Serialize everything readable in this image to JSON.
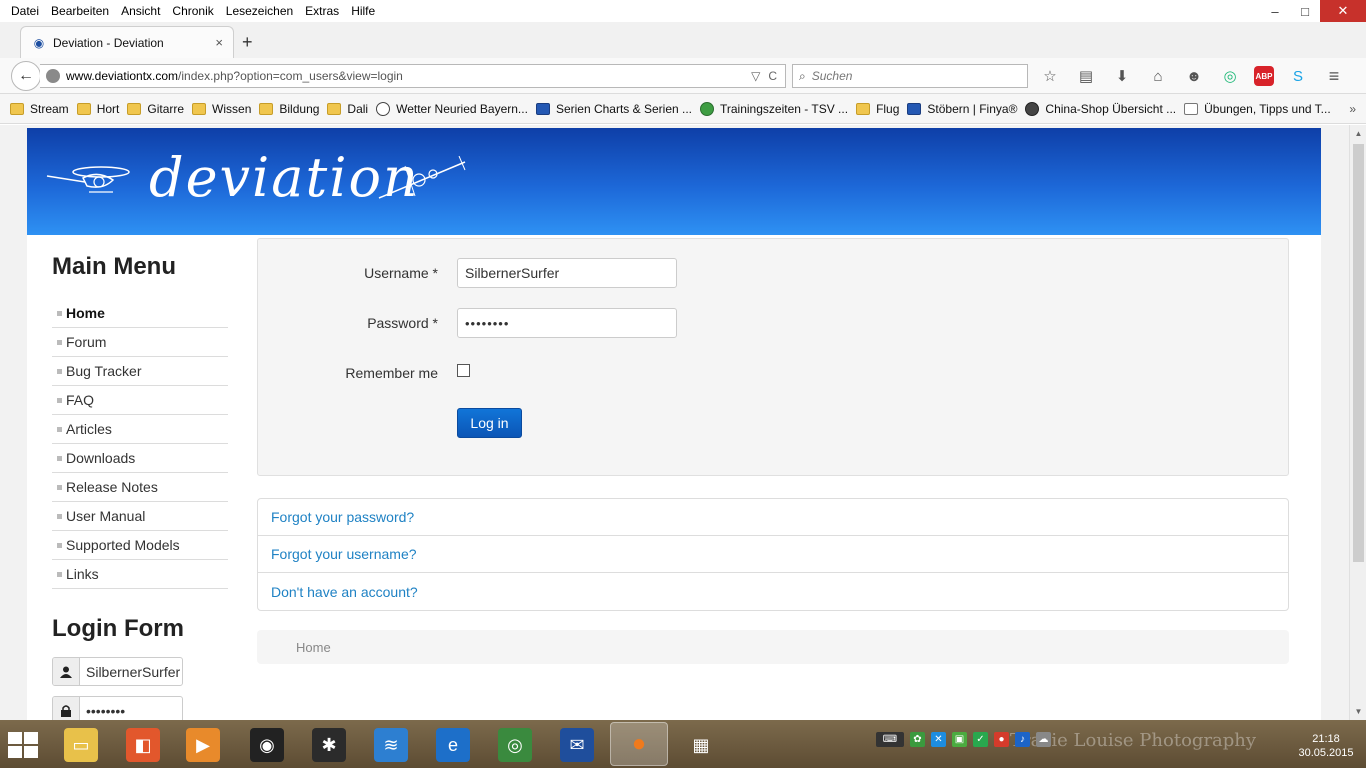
{
  "menubar": {
    "items": [
      "Datei",
      "Bearbeiten",
      "Ansicht",
      "Chronik",
      "Lesezeichen",
      "Extras",
      "Hilfe"
    ],
    "underline_first": [
      "D",
      "B",
      "A",
      "C",
      "L",
      "E",
      "H"
    ]
  },
  "window_controls": {
    "minimize": "–",
    "maximize": "□",
    "close": "✕"
  },
  "tab": {
    "title": "Deviation - Deviation",
    "close": "×",
    "new_tab": "+"
  },
  "address": {
    "domain": "www.deviationtx.com",
    "path": "/index.php?option=com_users&view=login",
    "scheme": "",
    "tail_dropdown": "▽",
    "tail_reload": "C"
  },
  "search": {
    "placeholder": "Suchen",
    "icon": "search-icon"
  },
  "toolbar_icons": [
    "star-icon",
    "reading-list-icon",
    "download-icon",
    "home-icon",
    "smiley-icon",
    "extension-icon",
    "adblock-icon",
    "skype-icon",
    "menu-icon"
  ],
  "adblock_label": "ABP",
  "bookmarks": [
    {
      "label": "Stream",
      "icon": "folder"
    },
    {
      "label": "Hort",
      "icon": "folder"
    },
    {
      "label": "Gitarre",
      "icon": "folder"
    },
    {
      "label": "Wissen",
      "icon": "folder"
    },
    {
      "label": "Bildung",
      "icon": "folder"
    },
    {
      "label": "Dali",
      "icon": "folder"
    },
    {
      "label": "Wetter Neuried Bayern...",
      "icon": "round"
    },
    {
      "label": "Serien Charts & Serien ...",
      "icon": "blue"
    },
    {
      "label": "Trainingszeiten - TSV ...",
      "icon": "green"
    },
    {
      "label": "Flug",
      "icon": "folder"
    },
    {
      "label": "Stöbern | Finya®",
      "icon": "blue"
    },
    {
      "label": "China-Shop Übersicht ...",
      "icon": "dark"
    },
    {
      "label": "Übungen, Tipps und T...",
      "icon": "box"
    }
  ],
  "bookmarks_more": "»",
  "site": {
    "logo_text": "deviation",
    "main_menu_title": "Main Menu",
    "menu_items": [
      "Home",
      "Forum",
      "Bug Tracker",
      "FAQ",
      "Articles",
      "Downloads",
      "Release Notes",
      "User Manual",
      "Supported Models",
      "Links"
    ],
    "active_menu": "Home",
    "login_form_title": "Login Form",
    "sidebar_username": "SilbernerSurfer",
    "sidebar_password": "••••••••"
  },
  "login": {
    "username_label": "Username *",
    "username_value": "SilbernerSurfer",
    "password_label": "Password *",
    "password_value": "••••••••",
    "remember_label": "Remember me",
    "remember_checked": false,
    "button": "Log in"
  },
  "help_links": [
    "Forgot your password?",
    "Forgot your username?",
    "Don't have an account?"
  ],
  "breadcrumb": "Home",
  "taskbar": {
    "watermark": "Tracie Louise Photography",
    "time": "21:18",
    "date": "30.05.2015"
  },
  "colors": {
    "banner_top": "#0e3fa8",
    "banner_bottom": "#2e91f3",
    "link": "#1f82c4",
    "button": "#0b55b6",
    "close_button": "#c7312b"
  }
}
